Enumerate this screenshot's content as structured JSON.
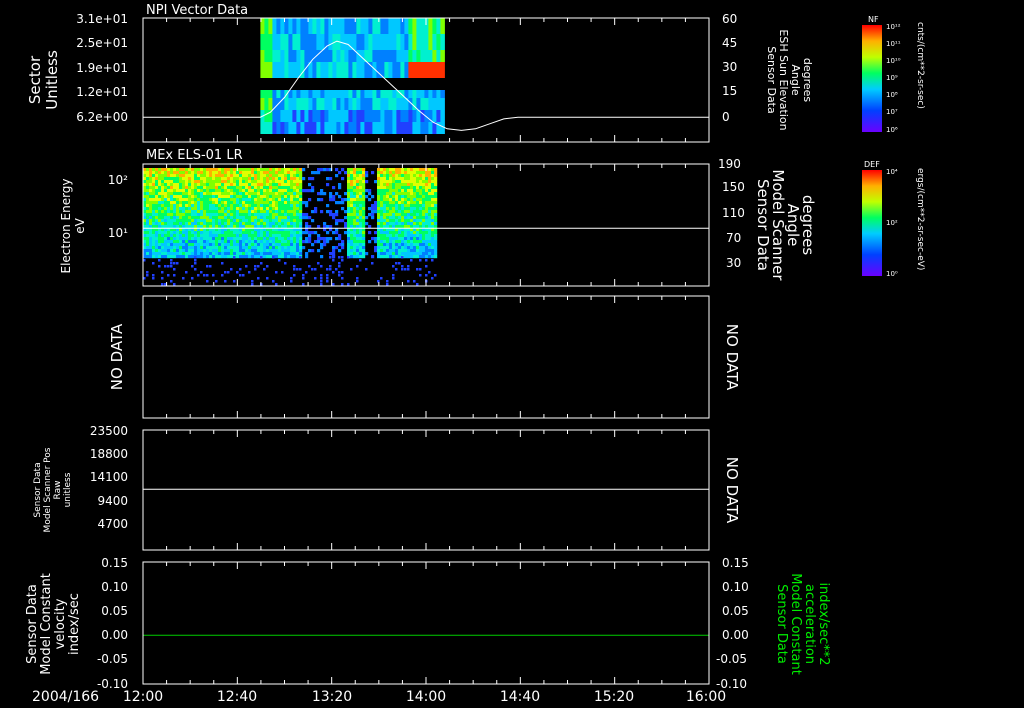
{
  "date_label": "2004/166",
  "time_axis": {
    "labels": [
      "12:00",
      "12:40",
      "13:20",
      "14:00",
      "14:40",
      "15:20",
      "16:00"
    ],
    "start_minutes": 720,
    "end_minutes": 960
  },
  "no_data_text": "NO DATA",
  "colors": {
    "trace": "#ffffff",
    "constant_line": "#00cc00",
    "right_label_panel5": "#00ee00"
  },
  "chart_data": [
    {
      "type": "heatmap",
      "title": "NPI Vector Data",
      "ylabel_lines": [
        "Sector",
        "Unitless"
      ],
      "yticks": [
        "3.1e+01",
        "2.5e+01",
        "1.9e+01",
        "1.2e+01",
        "6.2e+00"
      ],
      "ylim": [
        0,
        31
      ],
      "right_ylabel_lines": [
        "Sensor Data",
        "ESH Sun Elevation",
        "Angle",
        "degrees"
      ],
      "right_yticks": [
        "60",
        "45",
        "30",
        "15",
        "0"
      ],
      "right_ylim": [
        -15,
        60
      ],
      "data_span_minutes": [
        12.83,
        14.11
      ],
      "elevation_trace": {
        "t": [
          12.0,
          12.83,
          12.9,
          13.0,
          13.1,
          13.2,
          13.3,
          13.37,
          13.45,
          13.55,
          13.7,
          13.85,
          13.95,
          14.05,
          14.15,
          14.25,
          14.35,
          14.45,
          14.55,
          14.65,
          14.75,
          14.8,
          16.0
        ],
        "deg": [
          0,
          0,
          3,
          12,
          24,
          35,
          43,
          46,
          44,
          36,
          24,
          12,
          4,
          -3,
          -7,
          -8,
          -7,
          -4,
          -1,
          0,
          0,
          0,
          0
        ]
      },
      "colorbar": {
        "label": "NF",
        "unit": "cnts/(cm**2-sr-sec)",
        "ticks": [
          "10¹²",
          "10¹¹",
          "10¹⁰",
          "10⁹",
          "10⁸",
          "10⁷",
          "10⁶"
        ]
      }
    },
    {
      "type": "heatmap",
      "title": "MEx ELS-01 LR",
      "ylabel_lines": [
        "Electron Energy",
        "eV"
      ],
      "yticks": [
        "10²",
        "10¹"
      ],
      "right_ylabel_lines": [
        "Sensor Data",
        "Model Scanner",
        "Angle",
        "degrees"
      ],
      "right_yticks": [
        "190",
        "150",
        "110",
        "70",
        "30"
      ],
      "right_ylim": [
        0,
        190
      ],
      "data_span_minutes": [
        12.0,
        14.07
      ],
      "scanner_angle_deg": 90,
      "colorbar": {
        "label": "DEF",
        "unit": "ergs/(cm**2-sr-sec-eV)",
        "ticks": [
          "10⁴",
          "10²",
          "10⁰"
        ]
      }
    },
    {
      "type": "line",
      "title": "",
      "left_text": "NO DATA",
      "right_text": "NO DATA"
    },
    {
      "type": "line",
      "ylabel_lines": [
        "Sensor Data",
        "Model Scanner Pos",
        "Raw",
        "unitless"
      ],
      "yticks": [
        "23500",
        "18800",
        "14100",
        "9400",
        "4700"
      ],
      "ylim": [
        0,
        23500
      ],
      "right_text": "NO DATA",
      "series": [
        {
          "t": [
            12.0,
            16.0
          ],
          "values": [
            11900,
            11900
          ]
        }
      ]
    },
    {
      "type": "line",
      "ylabel_lines": [
        "Sensor Data",
        "Model Constant",
        "velocity",
        "index/sec"
      ],
      "yticks": [
        "0.15",
        "0.10",
        "0.05",
        "0.00",
        "-0.05",
        "-0.10"
      ],
      "ylim": [
        -0.1,
        0.15
      ],
      "right_ylabel_lines": [
        "Sensor Data",
        "Model Constant",
        "acceleration",
        "index/sec**2"
      ],
      "right_yticks": [
        "0.15",
        "0.10",
        "0.05",
        "0.00",
        "-0.05",
        "-0.10"
      ],
      "series": [
        {
          "t": [
            12.0,
            16.0
          ],
          "values": [
            0.0,
            0.0
          ]
        }
      ]
    }
  ]
}
